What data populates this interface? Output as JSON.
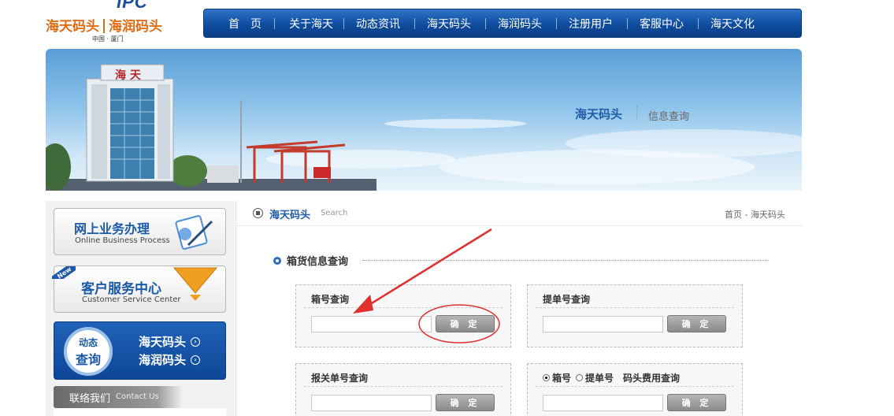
{
  "logo": {
    "brand": "IPC",
    "name_left": "海天码头",
    "name_right": "海润码头",
    "location": "中国 · 厦门"
  },
  "nav": {
    "items": [
      {
        "label": "首　页"
      },
      {
        "label": "关于海天"
      },
      {
        "label": "动态资讯"
      },
      {
        "label": "海天码头"
      },
      {
        "label": "海润码头"
      },
      {
        "label": "注册用户"
      },
      {
        "label": "客服中心"
      },
      {
        "label": "海天文化"
      }
    ]
  },
  "banner": {
    "building_sign": "海 天",
    "title": "海天码头",
    "subtitle": "信息查询"
  },
  "sidebar": {
    "online_business": {
      "title": "网上业务办理",
      "subtitle": "Online Business Process"
    },
    "customer_service": {
      "badge": "New",
      "title": "客户服务中心",
      "subtitle": "Customer Service Center"
    },
    "dynamic_query": {
      "line1": "动态",
      "line2": "查询",
      "links": [
        "海天码头",
        "海润码头"
      ]
    },
    "contact": {
      "title": "联络我们",
      "subtitle": "Contact Us"
    }
  },
  "main": {
    "header_title": "海天码头",
    "header_search": "Search",
    "breadcrumb": "首页 - 海天码头",
    "section_title": "箱货信息查询",
    "boxes": [
      {
        "label": "箱号查询",
        "button": "确 定"
      },
      {
        "label": "提单号查询",
        "button": "确 定"
      },
      {
        "label": "报关单号查询",
        "button": "确 定"
      },
      {
        "radio_1": "箱号",
        "radio_2": "提单号",
        "label": "码头费用查询",
        "button": "确 定"
      }
    ]
  },
  "colors": {
    "nav_blue": "#0f4c9e",
    "brand_orange": "#e06b12",
    "title_blue": "#1f5da8",
    "annotation_red": "#e03030"
  }
}
